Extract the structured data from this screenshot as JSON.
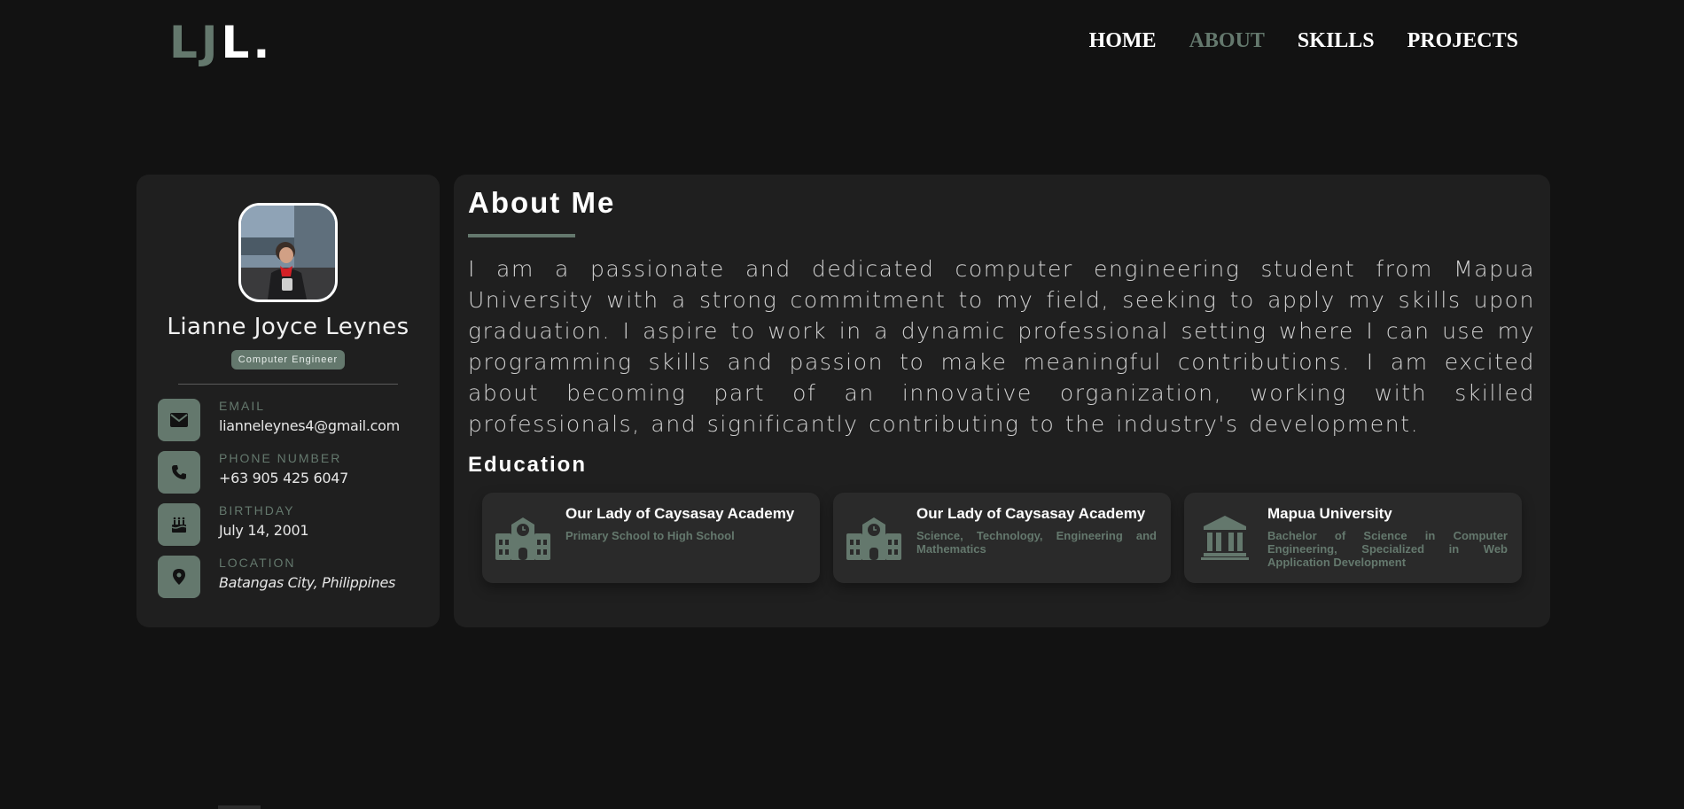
{
  "logo": {
    "part1": "LJ",
    "part2": "L."
  },
  "nav": {
    "items": [
      {
        "label": "HOME",
        "active": false
      },
      {
        "label": "ABOUT",
        "active": true
      },
      {
        "label": "SKILLS",
        "active": false
      },
      {
        "label": "PROJECTS",
        "active": false
      }
    ]
  },
  "profile": {
    "name": "Lianne Joyce Leynes",
    "role": "Computer Engineer",
    "contacts": [
      {
        "label": "EMAIL",
        "value": "lianneleynes4@gmail.com",
        "icon": "envelope-icon"
      },
      {
        "label": "PHONE NUMBER",
        "value": "+63 905 425 6047",
        "icon": "phone-icon"
      },
      {
        "label": "BIRTHDAY",
        "value": "July 14, 2001",
        "icon": "cake-icon"
      },
      {
        "label": "LOCATION",
        "value": "Batangas City, Philippines",
        "icon": "location-pin-icon"
      }
    ]
  },
  "about": {
    "title": "About Me",
    "bio": "I am a passionate and dedicated computer engineering student from Mapua University with a strong commitment to my field, seeking to apply my skills upon graduation. I aspire to work in a dynamic professional setting where I can use my programming skills and passion to make meaningful contributions. I am excited about becoming part of an innovative organization, working with skilled professionals, and significantly contributing to the industry's development."
  },
  "education": {
    "title": "Education",
    "items": [
      {
        "school": "Our Lady of Caysasay Academy",
        "detail": "Primary School to High School",
        "icon": "school-icon"
      },
      {
        "school": "Our Lady of Caysasay Academy",
        "detail": "Science, Technology, Engineering and Mathematics",
        "icon": "school-icon"
      },
      {
        "school": "Mapua University",
        "detail": "Bachelor of Science in Computer Engineering, Specialized in Web Application Development",
        "icon": "university-icon"
      }
    ]
  },
  "colors": {
    "background": "#121212",
    "card": "#1f1f1f",
    "accent": "#64786d",
    "text": "#ffffff"
  }
}
